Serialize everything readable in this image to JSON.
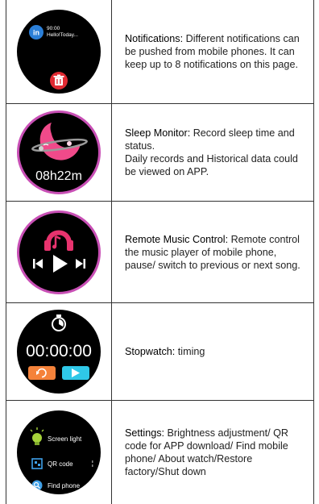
{
  "rows": [
    {
      "title": "Notifications:",
      "desc": " Different notifications can be pushed from mobile phones. It can keep up to 8 notifications on this page.",
      "screen": {
        "app_icon": "in",
        "time": "90:00",
        "message": "Hello!Today..."
      }
    },
    {
      "title": "Sleep Monitor:",
      "desc": " Record sleep time and status.",
      "desc2": "Daily records and Historical data could be viewed on APP.",
      "screen": {
        "duration": "08h22m"
      }
    },
    {
      "title": "Remote Music Control:",
      "desc": " Remote control the music player of mobile phone, pause/ switch to previous or next song.",
      "screen": {}
    },
    {
      "title": "Stopwatch:",
      "desc": " timing",
      "screen": {
        "time": "00:00:00"
      }
    },
    {
      "title": "Settings:",
      "desc": " Brightness adjustment/ QR code for APP download/ Find mobile phone/ About watch/Restore factory/Shut down",
      "screen": {
        "items": [
          "Screen light",
          "QR code",
          "Find phone"
        ]
      }
    }
  ],
  "colors": {
    "accent_pink": "#e8336e",
    "sleep_pink": "#f04a8a",
    "orange": "#f5823a",
    "cyan": "#2fc8e8",
    "ring": "#c84fb5"
  }
}
